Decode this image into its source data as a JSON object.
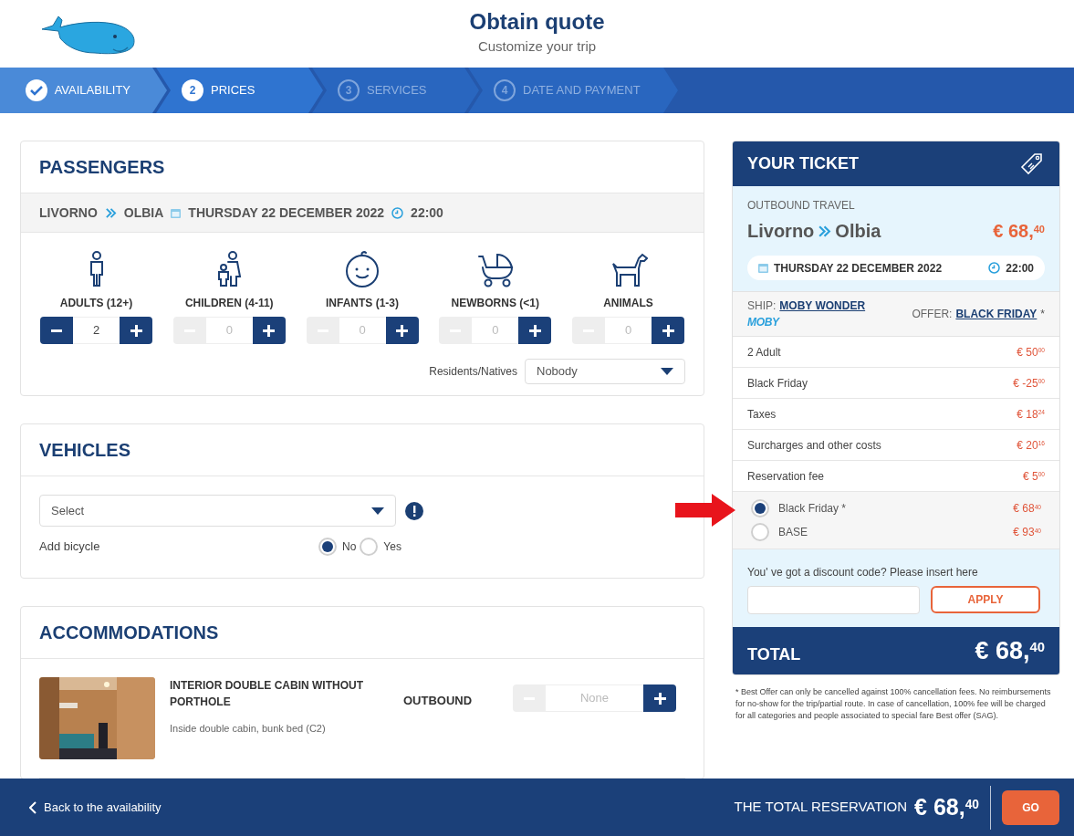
{
  "header": {
    "title": "Obtain quote",
    "subtitle": "Customize your trip"
  },
  "steps": [
    {
      "label": "AVAILABILITY",
      "completed": true,
      "selected": false
    },
    {
      "number": "2",
      "label": "PRICES",
      "completed": false,
      "selected": true
    },
    {
      "number": "3",
      "label": "SERVICES",
      "completed": false,
      "selected": false
    },
    {
      "number": "4",
      "label": "DATE AND PAYMENT",
      "completed": false,
      "selected": false
    }
  ],
  "passengers": {
    "title": "PASSENGERS",
    "route": {
      "from": "LIVORNO",
      "to": "OLBIA",
      "date": "THURSDAY 22 DECEMBER 2022",
      "time": "22:00"
    },
    "categories": [
      {
        "kind": "adult",
        "label": "ADULTS (12+)",
        "value": "2",
        "minus_disabled": false
      },
      {
        "kind": "child",
        "label": "CHILDREN (4-11)",
        "value": "0",
        "minus_disabled": true
      },
      {
        "kind": "infant",
        "label": "INFANTS (1-3)",
        "value": "0",
        "minus_disabled": true
      },
      {
        "kind": "newborn",
        "label": "NEWBORNS (<1)",
        "value": "0",
        "minus_disabled": true
      },
      {
        "kind": "animal",
        "label": "ANIMALS",
        "value": "0",
        "minus_disabled": true
      }
    ],
    "residents": {
      "label": "Residents/Natives",
      "value": "Nobody"
    }
  },
  "vehicles": {
    "title": "VEHICLES",
    "select": {
      "value": "Select"
    },
    "bicycle": {
      "label": "Add bicycle",
      "options": [
        {
          "label": "No",
          "selected": true
        },
        {
          "label": "Yes",
          "selected": false
        }
      ]
    }
  },
  "accommodations": {
    "title": "ACCOMMODATIONS",
    "items": [
      {
        "name": "INTERIOR DOUBLE CABIN WITHOUT PORTHOLE",
        "description": "Inside double cabin, bunk bed (C2)",
        "direction": "OUTBOUND",
        "value": "None",
        "minus_disabled": true
      }
    ]
  },
  "ticket": {
    "title": "YOUR TICKET",
    "direction": "OUTBOUND TRAVEL",
    "from": "Livorno",
    "to": "Olbia",
    "price": "€ 68,$^{40}$",
    "date": "THURSDAY 22 DECEMBER 2022",
    "time": "22:00",
    "ship_label": "SHIP:",
    "ship": "MOBY WONDER",
    "logo": "MOBY",
    "offer_label": "OFFER:",
    "offer": "BLACK FRIDAY",
    "offer_mark": "*",
    "lines": [
      {
        "label": "2 Adult",
        "amount": "€ 50$^{00}$"
      },
      {
        "label": "Black Friday",
        "amount": "€ -25$^{00}$"
      },
      {
        "label": "Taxes",
        "amount": "€ 18$^{24}$"
      },
      {
        "label": "Surcharges and other costs",
        "amount": "€ 20$^{16}$"
      },
      {
        "label": "Reservation fee",
        "amount": "€ 5$^{00}$"
      }
    ],
    "fares": [
      {
        "label": "Black Friday *",
        "amount": "€ 68$^{40}$",
        "selected": true
      },
      {
        "label": "BASE",
        "amount": "€ 93$^{40}$",
        "selected": false
      }
    ],
    "discount": {
      "label": "You' ve got a discount code? Please insert here",
      "button": "APPLY"
    },
    "total_label": "TOTAL",
    "total": "€ 68,$^{40}$",
    "note": "* Best Offer can only be cancelled against 100% cancellation fees. No reimbursements for no-show for the trip/partial route. In case of cancellation, 100% fee will be charged for all categories and people associated to special fare Best offer (SAG)."
  },
  "footer": {
    "back": "Back to the availability",
    "total_label": "THE TOTAL RESERVATION",
    "total": "€ 68,$^{40}$",
    "button": "GO"
  }
}
